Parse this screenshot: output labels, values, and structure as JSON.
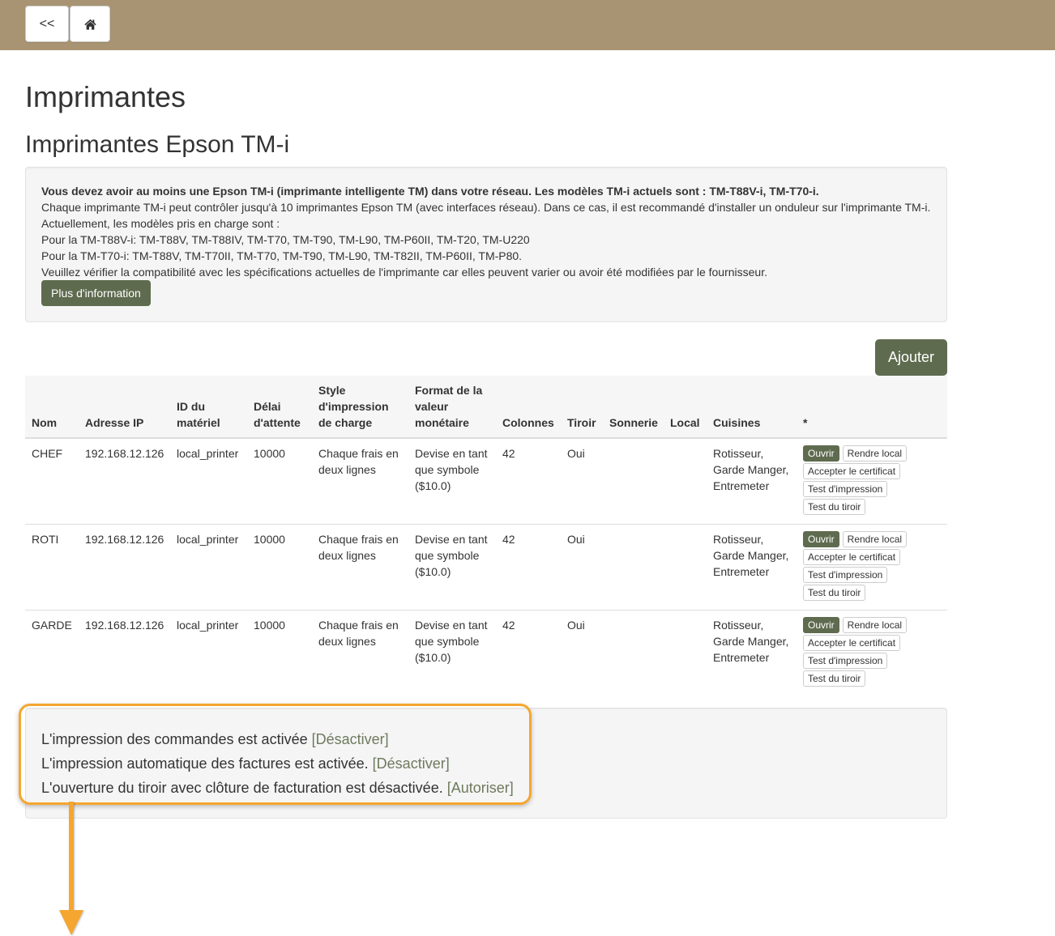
{
  "colors": {
    "topbar": "#a89472",
    "primary": "#5f6b4f",
    "link": "#6c7a5d",
    "annotation": "#f5a630"
  },
  "nav": {
    "back_label": "<<",
    "home_icon": "home-icon"
  },
  "page": {
    "title": "Imprimantes",
    "subtitle": "Imprimantes Epson TM-i"
  },
  "info": {
    "intro_bold": "Vous devez avoir au moins une Epson TM-i (imprimante intelligente TM) dans votre réseau. Les modèles TM-i actuels sont : TM-T88V-i, TM-T70-i.",
    "lines": [
      "Chaque imprimante TM-i peut contrôler jusqu'à 10 imprimantes Epson TM (avec interfaces réseau). Dans ce cas, il est recommandé d'installer un onduleur sur l'imprimante TM-i.",
      "Actuellement, les modèles pris en charge sont :",
      "Pour la TM-T88V-i: TM-T88V, TM-T88IV, TM-T70, TM-T90, TM-L90, TM-P60II, TM-T20, TM-U220",
      "Pour la TM-T70-i: TM-T88V, TM-T70II, TM-T70, TM-T90, TM-L90, TM-T82II, TM-P60II, TM-P80.",
      "Veuillez vérifier la compatibilité avec les spécifications actuelles de l'imprimante car elles peuvent varier ou avoir été modifiées par le fournisseur."
    ],
    "more_button": "Plus d'information"
  },
  "add_button": "Ajouter",
  "table": {
    "headers": {
      "name": "Nom",
      "ip": "Adresse IP",
      "hardware_id": "ID du matériel",
      "timeout": "Délai d'attente",
      "print_style": "Style d'impression de charge",
      "currency_format": "Format de la valeur monétaire",
      "columns": "Colonnes",
      "drawer": "Tiroir",
      "bell": "Sonnerie",
      "local": "Local",
      "kitchens": "Cuisines",
      "actions": "*"
    },
    "actions": {
      "open": "Ouvrir",
      "make_local": "Rendre local",
      "accept_certificate": "Accepter le certificat",
      "test_print": "Test d'impression",
      "test_drawer": "Test du tiroir"
    },
    "rows": [
      {
        "name": "CHEF",
        "ip": "192.168.12.126",
        "hardware_id": "local_printer",
        "timeout": "10000",
        "print_style": "Chaque frais en deux lignes",
        "currency_format": "Devise en tant que symbole ($10.0)",
        "columns": "42",
        "drawer": "Oui",
        "kitchens": "Rotisseur, Garde Manger, Entremeter"
      },
      {
        "name": "ROTI",
        "ip": "192.168.12.126",
        "hardware_id": "local_printer",
        "timeout": "10000",
        "print_style": "Chaque frais en deux lignes",
        "currency_format": "Devise en tant que symbole ($10.0)",
        "columns": "42",
        "drawer": "Oui",
        "kitchens": "Rotisseur, Garde Manger, Entremeter"
      },
      {
        "name": "GARDE",
        "ip": "192.168.12.126",
        "hardware_id": "local_printer",
        "timeout": "10000",
        "print_style": "Chaque frais en deux lignes",
        "currency_format": "Devise en tant que symbole ($10.0)",
        "columns": "42",
        "drawer": "Oui",
        "kitchens": "Rotisseur, Garde Manger, Entremeter"
      }
    ]
  },
  "status": {
    "lines": [
      {
        "text": "L'impression des commandes est activée",
        "action": "[Désactiver]"
      },
      {
        "text": "L'impression automatique des factures est activée.",
        "action": "[Désactiver]"
      },
      {
        "text": "L'ouverture du tiroir avec clôture de facturation est désactivée.",
        "action": "[Autoriser]"
      }
    ]
  }
}
